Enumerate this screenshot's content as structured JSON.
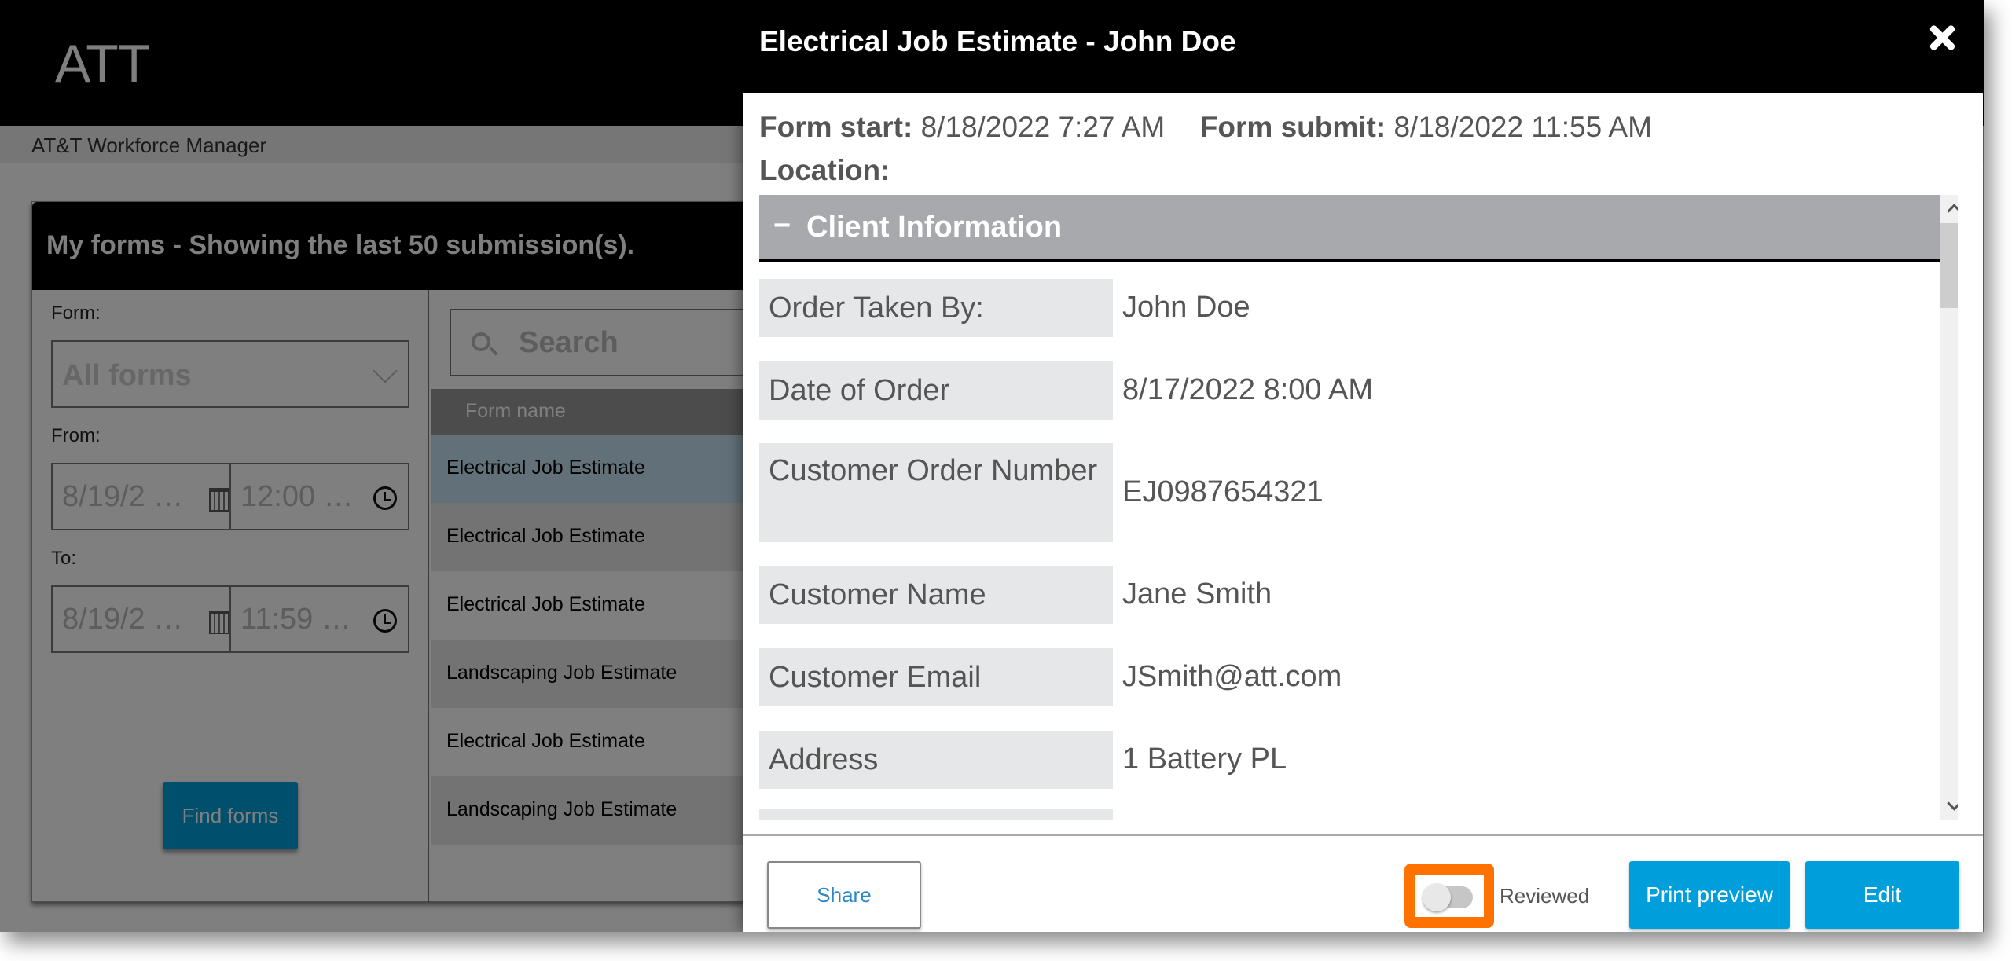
{
  "app": {
    "logo": "ATT",
    "subtitle": "AT&T Workforce Manager"
  },
  "panel": {
    "title": "My forms - Showing the last 50 submission(s).",
    "filters": {
      "form_label": "Form:",
      "form_value": "All forms",
      "from_label": "From:",
      "from_date": "8/19/2 …",
      "from_time": "12:00 …",
      "to_label": "To:",
      "to_date": "8/19/2 …",
      "to_time": "11:59 …",
      "find_button": "Find forms"
    },
    "list": {
      "search_placeholder": "Search",
      "column_header": "Form name",
      "rows": [
        {
          "name": "Electrical Job Estimate",
          "state": "selected"
        },
        {
          "name": "Electrical Job Estimate",
          "state": "alt"
        },
        {
          "name": "Electrical Job Estimate",
          "state": "normal"
        },
        {
          "name": "Landscaping Job Estimate",
          "state": "alt"
        },
        {
          "name": "Electrical Job Estimate",
          "state": "normal"
        },
        {
          "name": "Landscaping Job Estimate",
          "state": "alt"
        }
      ]
    }
  },
  "modal": {
    "title": "Electrical Job Estimate - John Doe",
    "close_icon": "close-icon",
    "meta": {
      "form_start_label": "Form start:",
      "form_start_value": "8/18/2022 7:27 AM",
      "form_submit_label": "Form submit:",
      "form_submit_value": "8/18/2022 11:55 AM",
      "location_label": "Location:",
      "location_value": ""
    },
    "section": {
      "toggle": "−",
      "title": "Client Information",
      "fields": [
        {
          "label": "Order Taken By:",
          "value": "John Doe"
        },
        {
          "label": "Date of Order",
          "value": "8/17/2022 8:00 AM"
        },
        {
          "label": "Customer Order Number",
          "value": "EJ0987654321"
        },
        {
          "label": "Customer Name",
          "value": "Jane Smith"
        },
        {
          "label": "Customer Email",
          "value": "JSmith@att.com"
        },
        {
          "label": "Address",
          "value": "1 Battery PL"
        }
      ]
    },
    "footer": {
      "share": "Share",
      "reviewed_label": "Reviewed",
      "reviewed_on": false,
      "print_preview": "Print preview",
      "edit": "Edit"
    }
  },
  "colors": {
    "accent": "#009fdb",
    "highlight": "#ff7200",
    "section_header": "#a7a9ac"
  }
}
